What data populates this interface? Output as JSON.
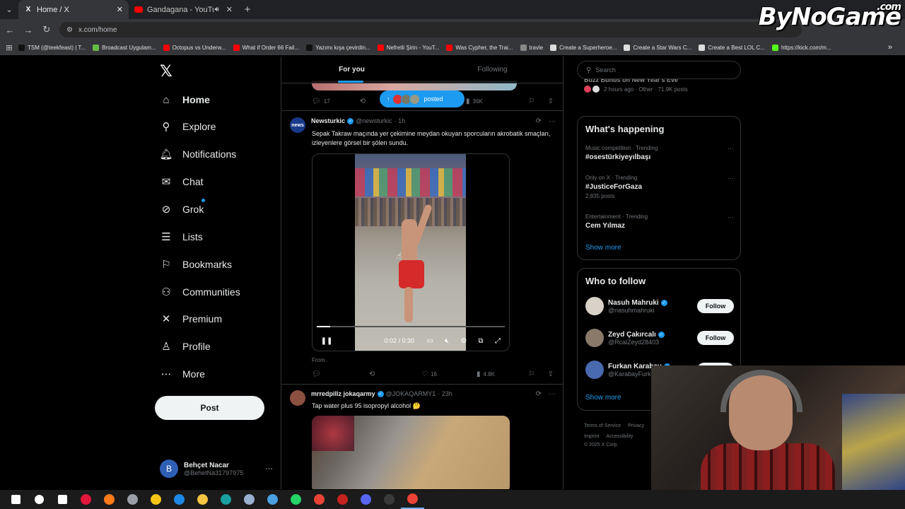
{
  "browser": {
    "tabs": [
      {
        "title": "Home / X",
        "active": true
      },
      {
        "title": "Gandagana - YouTube",
        "active": false
      }
    ],
    "url": "x.com/home",
    "bookmarks": [
      {
        "label": "TSM (@teekfeast) | T...",
        "color": "#111111"
      },
      {
        "label": "Broadcast Uygulam...",
        "color": "#66bb44"
      },
      {
        "label": "Octopus vs Underw...",
        "color": "#ff0000"
      },
      {
        "label": "What if Order 66 Fail...",
        "color": "#ff0000"
      },
      {
        "label": "Yazımı kışa çevirdin...",
        "color": "#111111"
      },
      {
        "label": "Nefretli Şirin - YouT...",
        "color": "#ff0000"
      },
      {
        "label": "Was Cypher, the Trai...",
        "color": "#ff0000"
      },
      {
        "label": "travle",
        "color": "#888888"
      },
      {
        "label": "Create a Superheroe...",
        "color": "#dddddd"
      },
      {
        "label": "Create a Star Wars C...",
        "color": "#dddddd"
      },
      {
        "label": "Create a Best LOL C...",
        "color": "#dddddd"
      },
      {
        "label": "https://kick.com/m...",
        "color": "#53fc18"
      }
    ]
  },
  "watermark": {
    "text": "ByNoGame",
    "suffix": ".com"
  },
  "sidebar": {
    "items": [
      {
        "label": "Home",
        "icon": "home-icon",
        "glyph": "⌂"
      },
      {
        "label": "Explore",
        "icon": "search-icon",
        "glyph": "⚲"
      },
      {
        "label": "Notifications",
        "icon": "bell-icon",
        "glyph": "🔔︎"
      },
      {
        "label": "Chat",
        "icon": "mail-icon",
        "glyph": "✉"
      },
      {
        "label": "Grok",
        "icon": "grok-icon",
        "glyph": "⊘"
      },
      {
        "label": "Lists",
        "icon": "list-icon",
        "glyph": "☰"
      },
      {
        "label": "Bookmarks",
        "icon": "bookmark-icon",
        "glyph": "⚐"
      },
      {
        "label": "Communities",
        "icon": "communities-icon",
        "glyph": "⚇"
      },
      {
        "label": "Premium",
        "icon": "x-icon",
        "glyph": "✕"
      },
      {
        "label": "Profile",
        "icon": "person-icon",
        "glyph": "♙"
      },
      {
        "label": "More",
        "icon": "more-circle-icon",
        "glyph": "⋯"
      }
    ],
    "post_label": "Post",
    "account": {
      "initial": "B",
      "name": "Behçet Nacar",
      "handle": "@BehetNa31797975"
    }
  },
  "feed": {
    "tabs": [
      "For you",
      "Following"
    ],
    "posted_pill": "posted",
    "prev_stats": {
      "replies": "17",
      "views": "36K"
    },
    "tweet1": {
      "name": "Newsturkic",
      "handle": "@newsturkic",
      "time": "· 1h",
      "avatar": "news",
      "text": "Sepak Takraw maçında yer çekimine meydan okuyan sporcuların akrobatik smaçları, izleyenlere görsel bir şölen sundu.",
      "video_time": "0:02 / 0:30",
      "video_progress": 0.07,
      "from": "From .",
      "likes": "16",
      "views": "4.8K"
    },
    "tweet2": {
      "name": "mrredpillz jokaqarmy",
      "handle": "@JOKAQARMY1",
      "time": "· 23h",
      "text": "Tap water plus 95 isopropyl alcohol 🤔"
    }
  },
  "right": {
    "search_placeholder": "Search",
    "top_trend": {
      "name": "Buzz Bunus on New Year's Eve",
      "meta": "2 hours ago · Other · 71.9K posts"
    },
    "whats_happening": {
      "title": "What's happening",
      "trends": [
        {
          "context": "Music competition · Trending",
          "name": "#osestürkiyeyılbaşı",
          "count": ""
        },
        {
          "context": "Only on X · Trending",
          "name": "#JusticeForGaza",
          "count": "2,835 posts"
        },
        {
          "context": "Entertainment · Trending",
          "name": "Cem Yılmaz",
          "count": ""
        }
      ],
      "show_more": "Show more"
    },
    "who_to_follow": {
      "title": "Who to follow",
      "users": [
        {
          "name": "Nasuh Mahruki",
          "handle": "@nasuhmahruki",
          "follow": "Follow",
          "color": "#d9d2c8"
        },
        {
          "name": "Zeyd Çakırcalı",
          "handle": "@RcalZeyd28403",
          "follow": "Follow",
          "color": "#8a7a6a"
        },
        {
          "name": "Furkan Karabay",
          "handle": "@KarabayFurk",
          "follow": "Follow",
          "color": "#4a6ab0"
        }
      ],
      "show_more": "Show more"
    },
    "footer": [
      "Terms of Service",
      "Privacy",
      "Imprint",
      "Accessibility",
      "© 2025 X Corp."
    ]
  },
  "taskbar": {
    "icons": [
      {
        "name": "windows-start-icon",
        "color": "#ffffff"
      },
      {
        "name": "taskbar-search-icon",
        "color": "#ffffff"
      },
      {
        "name": "task-view-icon",
        "color": "#ffffff"
      },
      {
        "name": "opera-gx-icon",
        "color": "#e0163a"
      },
      {
        "name": "firefox-icon",
        "color": "#ff7a18"
      },
      {
        "name": "app-icon",
        "color": "#9aa0a6"
      },
      {
        "name": "store-icon",
        "color": "#f5c518"
      },
      {
        "name": "mail-app-icon",
        "color": "#1e88e5"
      },
      {
        "name": "file-explorer-icon",
        "color": "#f5c542"
      },
      {
        "name": "edge-icon",
        "color": "#1aa0a0"
      },
      {
        "name": "monitor-icon",
        "color": "#9ab0d0"
      },
      {
        "name": "photos-icon",
        "color": "#4aa0e0"
      },
      {
        "name": "whatsapp-icon",
        "color": "#25d366"
      },
      {
        "name": "chrome-icon",
        "color": "#ea4335"
      },
      {
        "name": "gmail-icon",
        "color": "#c5221f"
      },
      {
        "name": "discord-icon",
        "color": "#5865f2"
      },
      {
        "name": "obs-icon",
        "color": "#3a3a3a"
      },
      {
        "name": "chrome-active-icon",
        "color": "#ea4335"
      }
    ]
  }
}
